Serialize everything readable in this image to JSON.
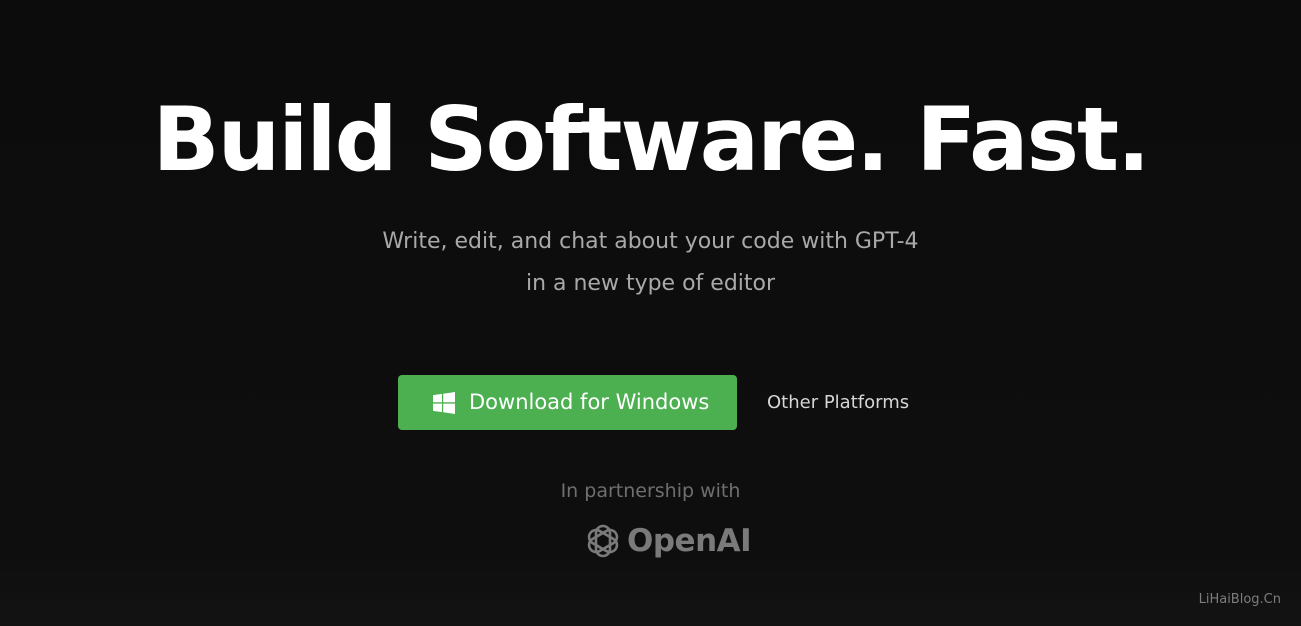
{
  "hero": {
    "title": "Build Software. Fast.",
    "subtitle_line1": "Write, edit, and chat about your code with GPT-4",
    "subtitle_line2": "in a new type of editor"
  },
  "actions": {
    "download_label": "Download for Windows",
    "download_icon": "windows-icon",
    "other_platforms_label": "Other Platforms"
  },
  "partnership": {
    "label": "In partnership with",
    "logo_text": "OpenAI",
    "logo_icon": "openai-icon"
  },
  "watermark": "LiHaiBlog.Cn",
  "colors": {
    "background": "#0d0d0d",
    "title": "#ffffff",
    "subtitle": "#a9a9a9",
    "button": "#4caf50",
    "muted": "#6f6f6f"
  }
}
